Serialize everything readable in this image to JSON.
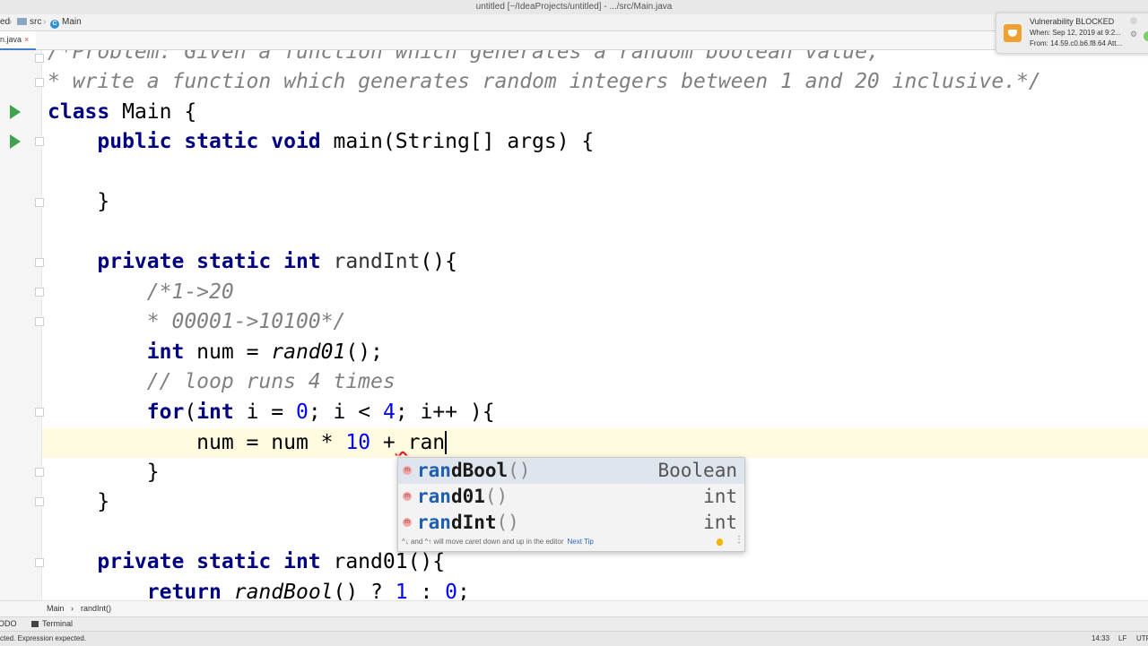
{
  "window": {
    "title": "untitled [~/IdeaProjects/untitled] - .../src/Main.java"
  },
  "navbar": {
    "project": "ed",
    "folder": "src",
    "file": "Main"
  },
  "tabs": [
    {
      "label": "n.java",
      "close": "×"
    }
  ],
  "code": {
    "line1": "/*Problem: Given a function which generates a random boolean value,",
    "line2": "* write a function which generates random integers between 1 and 20 inclusive.*/",
    "class_kw": "class",
    "class_rest": " Main {",
    "main_mods": "public static void",
    "main_rest": " main(String[] args) {",
    "close_brace": "}",
    "randint_mods": "private static int",
    "randint_name": " randInt",
    "randint_rest": "(){",
    "comment1": "/*1->20",
    "comment2": "* 00001->10100*/",
    "int_kw": "int",
    "num_decl": " num = ",
    "rand01_call": "rand01",
    "call_end": "();",
    "comment3": "// loop runs 4 times",
    "for_kw": "for",
    "for_open": "(",
    "for_int": "int",
    "for_mid1": " i = ",
    "zero": "0",
    "for_mid2": "; i < ",
    "four": "4",
    "for_end": "; i++ ){",
    "typed_prefix": "num = num * ",
    "ten": "10",
    "plus": " +",
    "space": " ",
    "typed": "ran",
    "rand01_mods": "private static int",
    "rand01_rest": " rand01(){",
    "return_kw": "return",
    "randbool_call": "randBool",
    "return_rest1": "() ? ",
    "one": "1",
    "return_rest2": " : ",
    "return_end": ";"
  },
  "autocomplete": {
    "items": [
      {
        "match": "ran",
        "rest": "dBool",
        "params": "()",
        "type": "Boolean",
        "selected": true
      },
      {
        "match": "ran",
        "rest": "d01",
        "params": "()",
        "type": "int",
        "selected": false
      },
      {
        "match": "ran",
        "rest": "dInt",
        "params": "()",
        "type": "int",
        "selected": false
      }
    ],
    "icon_glyph": "m",
    "tip": "^↓ and ^↑ will move caret down and up in the editor",
    "next_tip": "Next Tip",
    "more": "⋮"
  },
  "notification": {
    "title": "Vulnerability BLOCKED",
    "when": "When: Sep 12, 2019 at 9:2...",
    "from": "From: 14.59.c0.b6.f8.64 Att..."
  },
  "breadcrumbs": {
    "class": "Main",
    "sep": "›",
    "method": "randInt()"
  },
  "toolwindows": {
    "todo": "ODO",
    "terminal": "Terminal"
  },
  "status": {
    "message": "cted. Expression expected.",
    "position": "14:33",
    "line_sep": "LF",
    "encoding": "UTF"
  },
  "colors": {
    "keyword": "#000080",
    "comment": "#808080",
    "number": "#0000ff",
    "match": "#2060b0",
    "run": "#3fa34d",
    "current_line": "#fffbe0"
  }
}
